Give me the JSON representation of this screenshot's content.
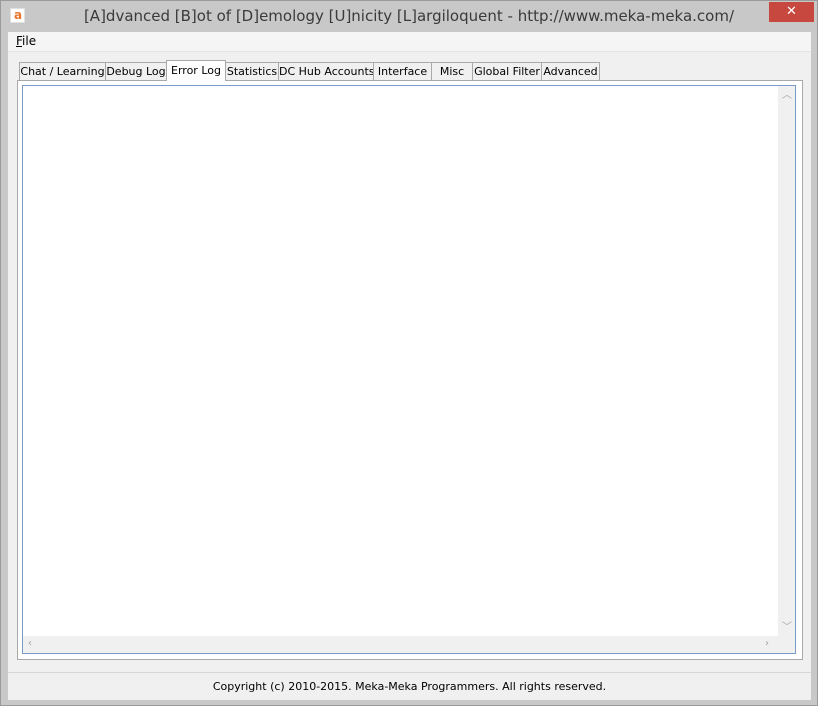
{
  "window": {
    "title": "[A]dvanced [B]ot of [D]emology [U]nicity [L]argiloquent - http://www.meka-meka.com/",
    "app_icon_letter": "a",
    "close_symbol": "✕"
  },
  "menu": {
    "file_underlined": "F",
    "file_rest": "ile"
  },
  "tabs": [
    {
      "label": "Chat / Learning"
    },
    {
      "label": "Debug Log"
    },
    {
      "label": "Error Log",
      "selected": true
    },
    {
      "label": "Statistics"
    },
    {
      "label": "DC Hub Accounts"
    },
    {
      "label": "Interface"
    },
    {
      "label": "Misc"
    },
    {
      "label": "Global Filter"
    },
    {
      "label": "Advanced"
    }
  ],
  "error_log": {
    "content": ""
  },
  "status": {
    "copyright": "Copyright (c) 2010-2015. Meka-Meka Programmers. All rights reserved."
  },
  "colors": {
    "close_button": "#c7483f",
    "textbox_border": "#7a9cc6"
  }
}
